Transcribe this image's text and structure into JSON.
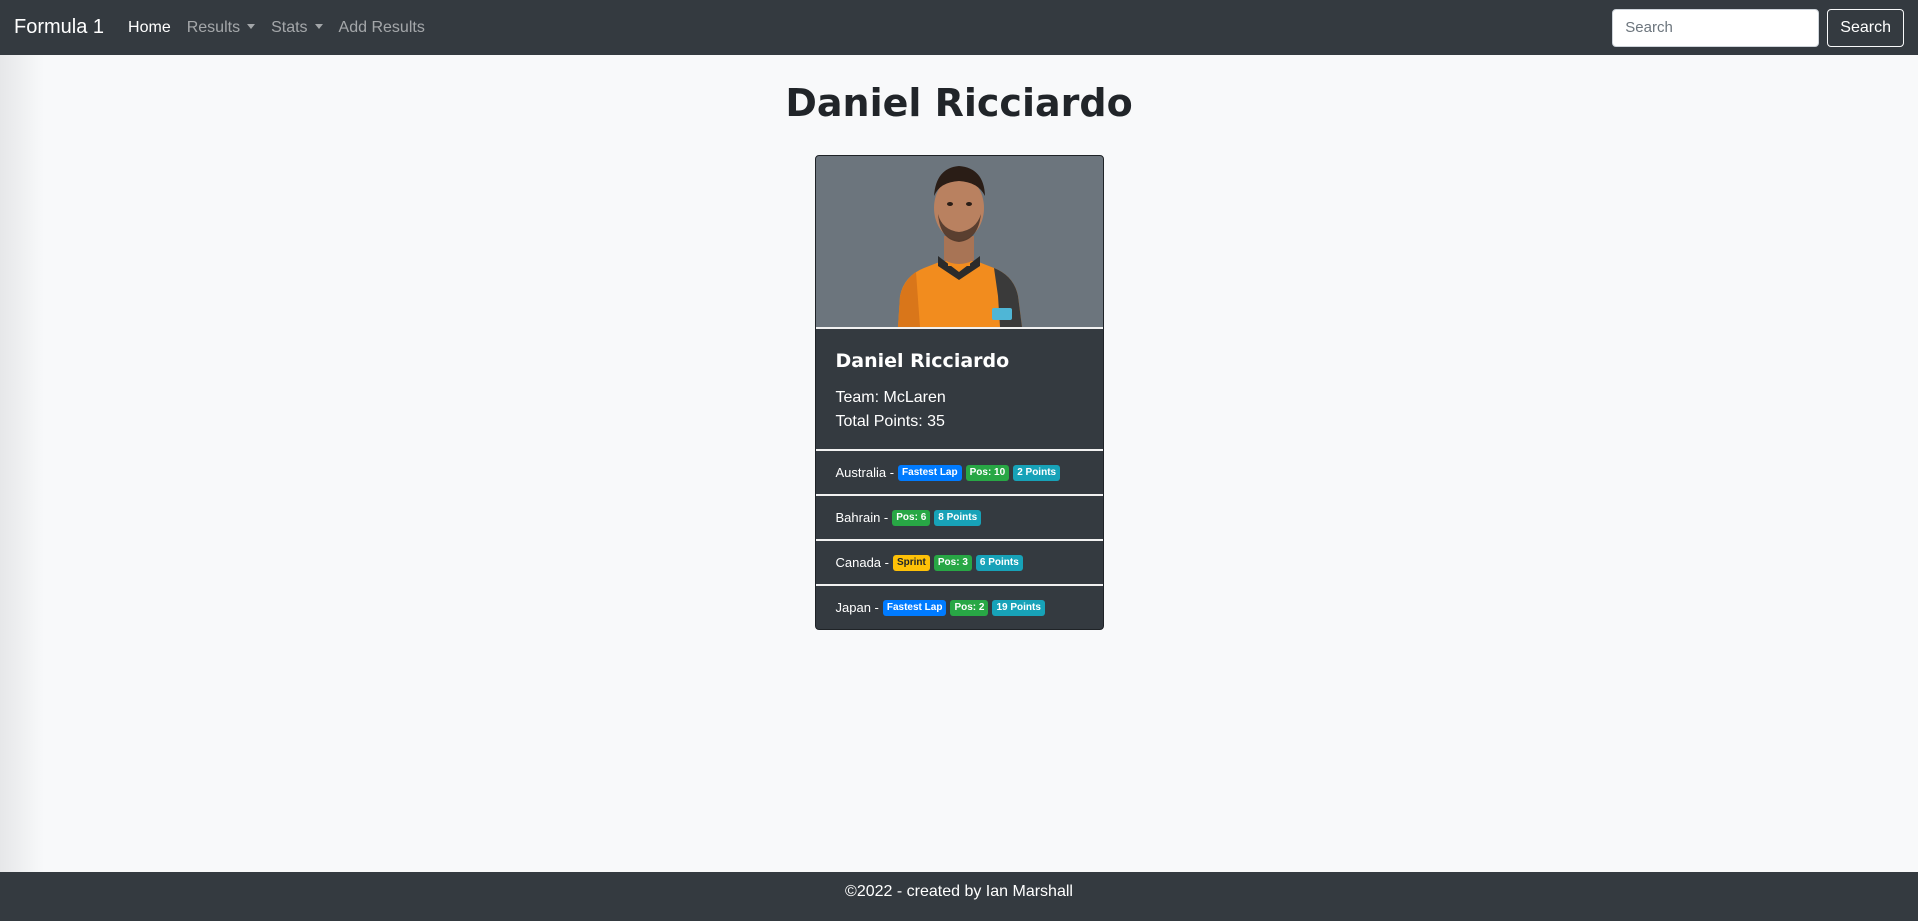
{
  "nav": {
    "brand": "Formula 1",
    "items": [
      {
        "label": "Home"
      },
      {
        "label": "Results"
      },
      {
        "label": "Stats"
      },
      {
        "label": "Add Results"
      }
    ],
    "search_placeholder": "Search",
    "search_button": "Search"
  },
  "page": {
    "title": "Daniel Ricciardo"
  },
  "driver": {
    "name": "Daniel Ricciardo",
    "team_text": "Team: McLaren",
    "points_text": "Total Points: 35",
    "results": [
      {
        "race": "Australia -",
        "badges": [
          "Fastest Lap",
          "Pos: 10",
          "2 Points"
        ]
      },
      {
        "race": "Bahrain -",
        "badges": [
          "Pos: 6",
          "8 Points"
        ]
      },
      {
        "race": "Canada -",
        "badges": [
          "Sprint",
          "Pos: 3",
          "6 Points"
        ]
      },
      {
        "race": "Japan -",
        "badges": [
          "Fastest Lap",
          "Pos: 2",
          "19 Points"
        ]
      }
    ]
  },
  "footer": {
    "text": "©2022 - created by Ian Marshall"
  },
  "colors": {
    "navbar": "#343a40",
    "fastest_lap": "#007bff",
    "position": "#28a745",
    "points": "#17a2b8",
    "sprint": "#ffc107",
    "driver_suit": "#f28c1e"
  }
}
